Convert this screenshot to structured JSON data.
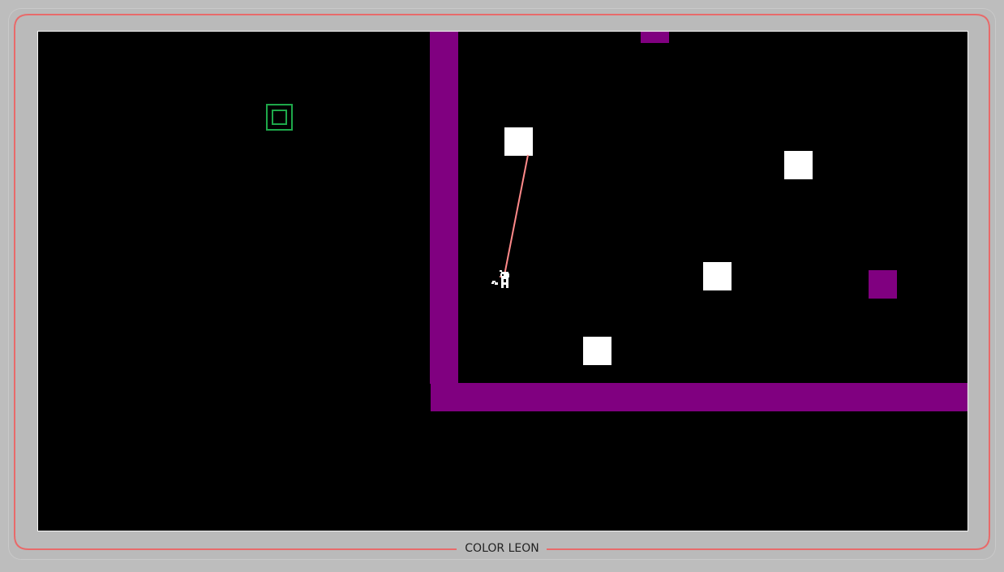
{
  "game": {
    "title": "COLOR LEON"
  },
  "colors": {
    "background": "#bdbdbd",
    "frame_line": "#e86a6a",
    "screen": "#000000",
    "wall": "#800080",
    "block_white": "#ffffff",
    "exit_goal": "#1ea84a",
    "tongue": "#ff8a8a",
    "player": "#ffffff"
  },
  "icons": {
    "player": "chameleon-player-icon",
    "exit": "exit-goal-icon"
  }
}
